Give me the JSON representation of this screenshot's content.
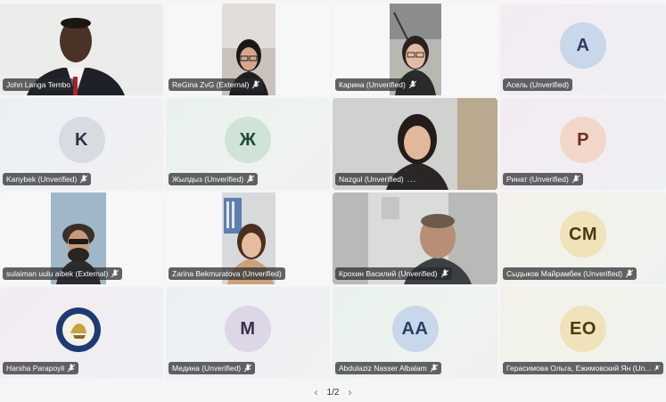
{
  "participants": [
    {
      "name": "John Langa Tembo"
    },
    {
      "name": "ReGina ZvG (External)"
    },
    {
      "name": "Карина (Unverified)"
    },
    {
      "name": "Асель (Unverified)",
      "initials": "A"
    },
    {
      "name": "Kanybek (Unverified)",
      "initials": "K"
    },
    {
      "name": "Жылдыз (Unverified)",
      "initials": "Ж"
    },
    {
      "name": "Nazgul (Unverified)"
    },
    {
      "name": "Ринат (Unverified)",
      "initials": "P"
    },
    {
      "name": "sulaiman uulu aibek (External)"
    },
    {
      "name": "Zarina Bekmuratova (Unverified)"
    },
    {
      "name": "Крохин Василий (Unverified)"
    },
    {
      "name": "Сыдыков Майрамбек (Unverified)",
      "initials": "CM"
    },
    {
      "name": "Harsha Parapoyil"
    },
    {
      "name": "Медина (Unverified)",
      "initials": "M"
    },
    {
      "name": "Abdulaziz Nasser Albalam",
      "initials": "AA"
    },
    {
      "name": "Герасимова Ольга, Ежимовский Ян (Un...",
      "initials": "EO"
    }
  ],
  "pager": {
    "label": "1/2",
    "prev_icon": "chevron-left-icon",
    "next_icon": "chevron-right-icon"
  },
  "more_label": "..."
}
